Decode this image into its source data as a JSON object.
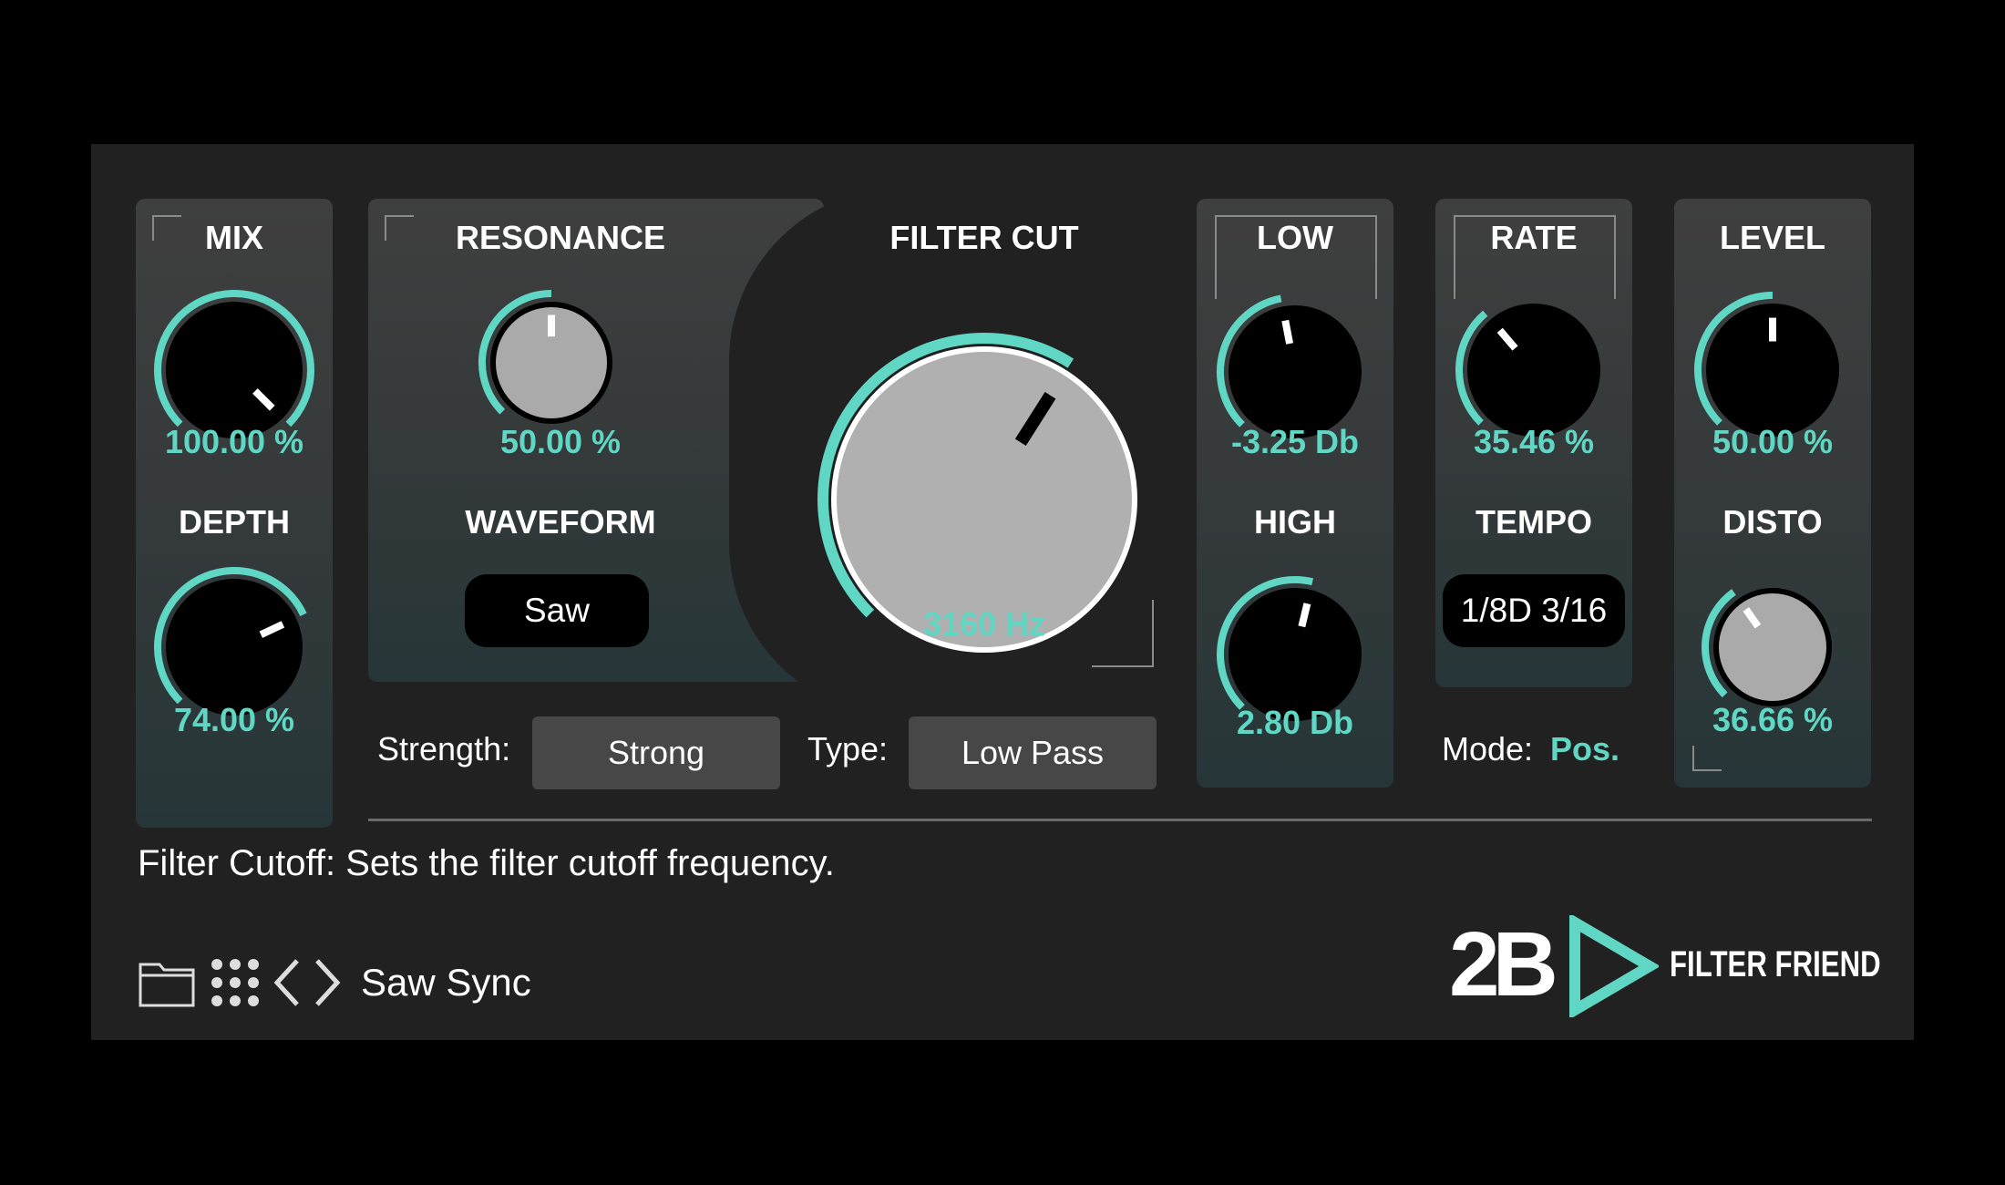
{
  "colors": {
    "accent": "#5fd7c4",
    "panel": "#3c3c3c",
    "background": "#212121"
  },
  "labels": {
    "mix": "MIX",
    "depth": "DEPTH",
    "resonance": "RESONANCE",
    "waveform": "WAVEFORM",
    "filter_cut": "FILTER CUT",
    "low": "LOW",
    "high": "HIGH",
    "rate": "RATE",
    "tempo": "TEMPO",
    "level": "LEVEL",
    "disto": "DISTO"
  },
  "values": {
    "mix": "100.00 %",
    "depth": "74.00 %",
    "resonance": "50.00 %",
    "filter_cut": "3160 Hz",
    "low": "-3.25 Db",
    "high": "2.80 Db",
    "rate": "35.46 %",
    "level": "50.00 %",
    "disto": "36.66 %"
  },
  "knob_levels": {
    "mix": 1.0,
    "depth": 0.74,
    "resonance": 0.5,
    "filter_cut": 0.62,
    "low": 0.46,
    "high": 0.55,
    "rate": 0.35,
    "level": 0.5,
    "disto": 0.37
  },
  "waveform": {
    "selected": "Saw"
  },
  "tempo": {
    "selected": "1/8D 3/16"
  },
  "strength": {
    "label": "Strength:",
    "selected": "Strong"
  },
  "type": {
    "label": "Type:",
    "selected": "Low Pass"
  },
  "mode": {
    "label": "Mode:",
    "value": "Pos."
  },
  "help_text": "Filter Cutoff: Sets the filter cutoff frequency.",
  "footer": {
    "preset_name": "Saw Sync",
    "icons": [
      "folder-icon",
      "grid-icon",
      "chevron-left-icon",
      "chevron-right-icon"
    ]
  },
  "brand": {
    "logo_mark": "2B",
    "product": "FILTER FRIEND"
  }
}
